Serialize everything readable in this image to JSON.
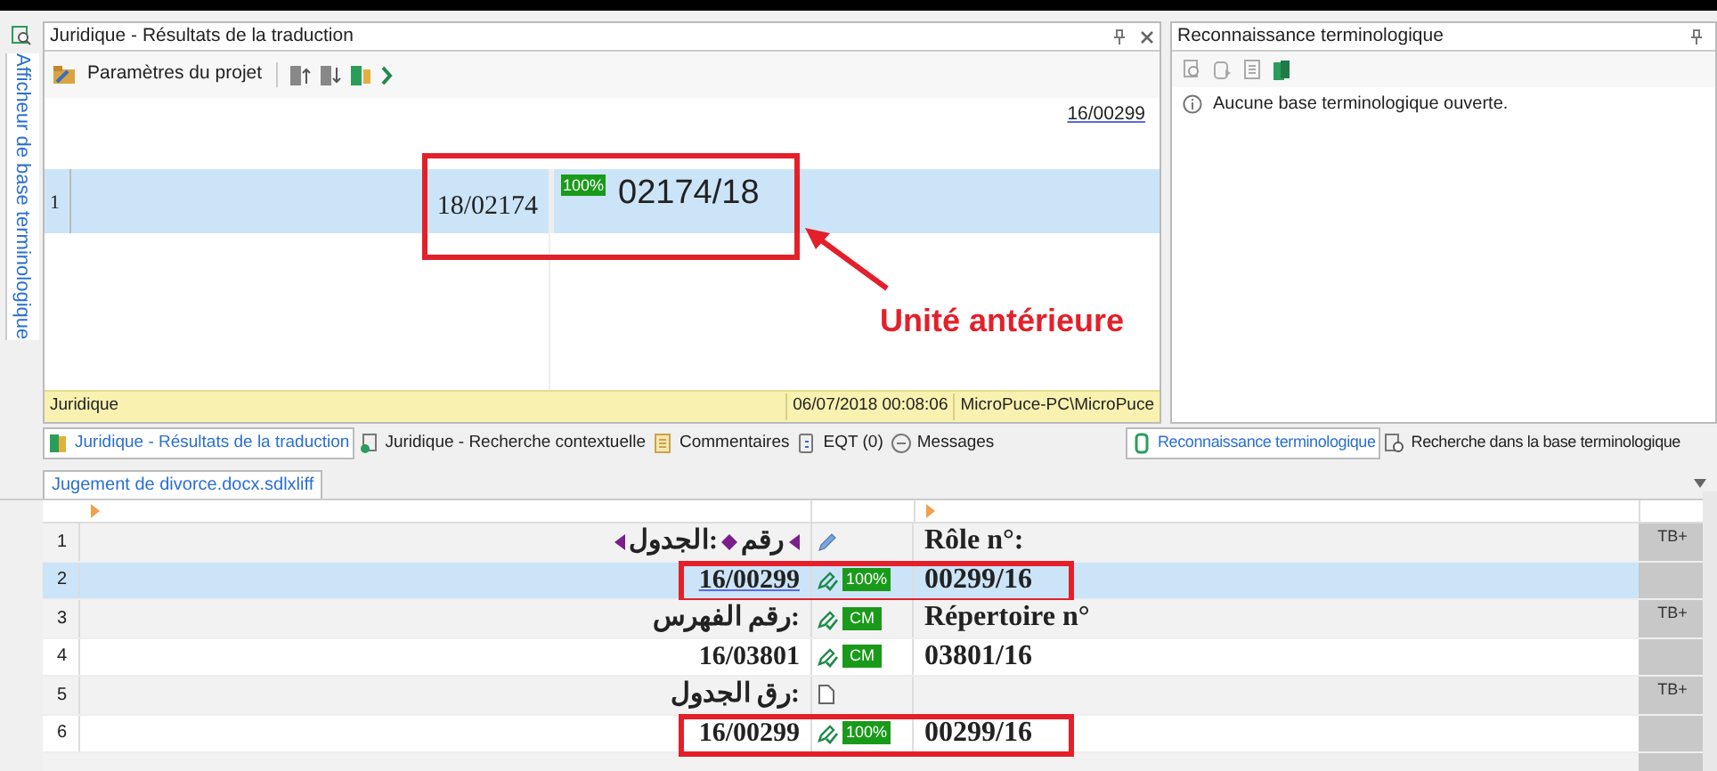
{
  "side_tab": {
    "label": "Afficheur de base terminologique"
  },
  "results_panel": {
    "title": "Juridique - Résultats de la traduction",
    "toolbar": {
      "project_settings": "Paramètres du projet"
    },
    "source_ref": "16/00299",
    "rows": [
      {
        "number": "1",
        "source": "18/02174",
        "match": "100%",
        "target": "02174/18",
        "selected": true
      }
    ],
    "status_bar": {
      "name": "Juridique",
      "date": "06/07/2018 00:08:06",
      "user": "MicroPuce-PC\\MicroPuce"
    }
  },
  "annotation": {
    "label": "Unité antérieure"
  },
  "term_panel": {
    "title": "Reconnaissance terminologique",
    "message": "Aucune base terminologique ouverte."
  },
  "bottom_tabs": [
    {
      "label": "Juridique - Résultats de la traduction",
      "selected": true
    },
    {
      "label": "Juridique - Recherche contextuelle",
      "selected": false
    },
    {
      "label": "Commentaires",
      "selected": false
    },
    {
      "label": "EQT (0)",
      "selected": false
    },
    {
      "label": "Messages",
      "selected": false
    }
  ],
  "right_tabs": [
    {
      "label": "Reconnaissance terminologique",
      "selected": true
    },
    {
      "label": "Recherche dans la base terminologique",
      "selected": false
    }
  ],
  "document_tab": {
    "label": "Jugement de divorce.docx.sdlxliff"
  },
  "segments": [
    {
      "number": "1",
      "source_segments": [
        "رقم",
        "الجدول:"
      ],
      "kind": "draft",
      "target": "Rôle n°:",
      "tb": "TB+",
      "selected": false,
      "highlighted": false
    },
    {
      "number": "2",
      "source_segments": [
        "16/00299"
      ],
      "kind": "translated",
      "badge": "100%",
      "target": "00299/16",
      "selected": true,
      "highlighted": true
    },
    {
      "number": "3",
      "source_segments": [
        "رقم الفهرس:"
      ],
      "kind": "translated",
      "badge": "CM",
      "target": "Répertoire n°",
      "tb": "TB+",
      "selected": false,
      "highlighted": false
    },
    {
      "number": "4",
      "source_segments": [
        "16/03801"
      ],
      "kind": "translated",
      "badge": "CM",
      "target": "03801/16",
      "selected": false,
      "highlighted": false
    },
    {
      "number": "5",
      "source_segments": [
        "رق الجدول:"
      ],
      "kind": "untranslated",
      "tb": "TB+",
      "selected": false,
      "highlighted": false
    },
    {
      "number": "6",
      "source_segments": [
        "16/00299"
      ],
      "kind": "translated",
      "badge": "100%",
      "target": "00299/16",
      "selected": false,
      "highlighted": true
    }
  ]
}
